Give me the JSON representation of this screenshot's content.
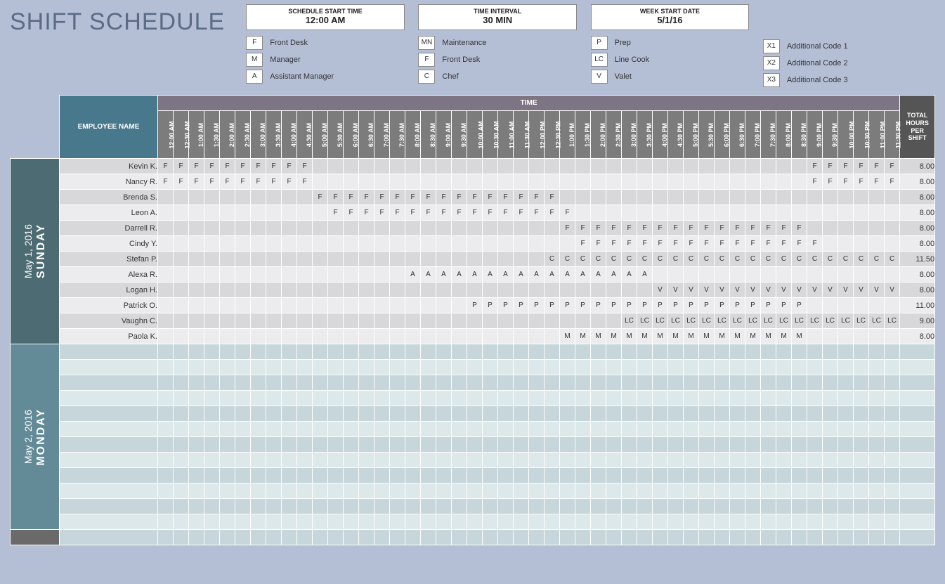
{
  "title": "SHIFT SCHEDULE",
  "params": [
    {
      "label": "SCHEDULE START TIME",
      "value": "12:00 AM"
    },
    {
      "label": "TIME INTERVAL",
      "value": "30 MIN"
    },
    {
      "label": "WEEK START DATE",
      "value": "5/1/16"
    }
  ],
  "legend_columns": [
    [
      {
        "code": "F",
        "text": "Front Desk"
      },
      {
        "code": "M",
        "text": "Manager"
      },
      {
        "code": "A",
        "text": "Assistant Manager"
      }
    ],
    [
      {
        "code": "MN",
        "text": "Maintenance"
      },
      {
        "code": "F",
        "text": "Front Desk"
      },
      {
        "code": "C",
        "text": "Chef"
      }
    ],
    [
      {
        "code": "P",
        "text": "Prep"
      },
      {
        "code": "LC",
        "text": "Line Cook"
      },
      {
        "code": "V",
        "text": "Valet"
      }
    ],
    [
      {
        "code": "X1",
        "text": "Additional Code 1"
      },
      {
        "code": "X2",
        "text": "Additional Code 2"
      },
      {
        "code": "X3",
        "text": "Additional Code 3"
      }
    ]
  ],
  "headers": {
    "employee": "EMPLOYEE NAME",
    "time_banner": "TIME",
    "total": "TOTAL HOURS PER SHIFT"
  },
  "time_slots": [
    "12:00 AM",
    "12:30 AM",
    "1:00 AM",
    "1:30 AM",
    "2:00 AM",
    "2:30 AM",
    "3:00 AM",
    "3:30 AM",
    "4:00 AM",
    "4:30 AM",
    "5:00 AM",
    "5:30 AM",
    "6:00 AM",
    "6:30 AM",
    "7:00 AM",
    "7:30 AM",
    "8:00 AM",
    "8:30 AM",
    "9:00 AM",
    "9:30 AM",
    "10:00 AM",
    "10:30 AM",
    "11:00 AM",
    "11:30 AM",
    "12:00 PM",
    "12:30 PM",
    "1:00 PM",
    "1:30 PM",
    "2:00 PM",
    "2:30 PM",
    "3:00 PM",
    "3:30 PM",
    "4:00 PM",
    "4:30 PM",
    "5:00 PM",
    "5:30 PM",
    "6:00 PM",
    "6:30 PM",
    "7:00 PM",
    "7:30 PM",
    "8:00 PM",
    "8:30 PM",
    "9:00 PM",
    "9:30 PM",
    "10:00 PM",
    "10:30 PM",
    "11:00 PM",
    "11:30 PM"
  ],
  "days": [
    {
      "name": "SUNDAY",
      "date": "May 1, 2016",
      "class": "sunday",
      "rows": [
        {
          "employee": "Kevin K.",
          "total": "8.00",
          "shift": {
            "code": "F",
            "ranges": [
              [
                0,
                9
              ],
              [
                42,
                47
              ]
            ]
          }
        },
        {
          "employee": "Nancy R.",
          "total": "8.00",
          "shift": {
            "code": "F",
            "ranges": [
              [
                0,
                9
              ],
              [
                42,
                47
              ]
            ]
          }
        },
        {
          "employee": "Brenda S.",
          "total": "8.00",
          "shift": {
            "code": "F",
            "ranges": [
              [
                10,
                25
              ]
            ]
          }
        },
        {
          "employee": "Leon A.",
          "total": "8.00",
          "shift": {
            "code": "F",
            "ranges": [
              [
                11,
                26
              ]
            ]
          }
        },
        {
          "employee": "Darrell R.",
          "total": "8.00",
          "shift": {
            "code": "F",
            "ranges": [
              [
                26,
                41
              ]
            ]
          }
        },
        {
          "employee": "Cindy Y.",
          "total": "8.00",
          "shift": {
            "code": "F",
            "ranges": [
              [
                27,
                42
              ]
            ]
          }
        },
        {
          "employee": "Stefan P.",
          "total": "11.50",
          "shift": {
            "code": "C",
            "ranges": [
              [
                25,
                47
              ]
            ]
          }
        },
        {
          "employee": "Alexa R.",
          "total": "8.00",
          "shift": {
            "code": "A",
            "ranges": [
              [
                16,
                31
              ]
            ]
          }
        },
        {
          "employee": "Logan H.",
          "total": "8.00",
          "shift": {
            "code": "V",
            "ranges": [
              [
                32,
                47
              ]
            ]
          }
        },
        {
          "employee": "Patrick O.",
          "total": "11.00",
          "shift": {
            "code": "P",
            "ranges": [
              [
                20,
                41
              ]
            ]
          }
        },
        {
          "employee": "Vaughn C.",
          "total": "9.00",
          "shift": {
            "code": "LC",
            "ranges": [
              [
                30,
                47
              ]
            ]
          }
        },
        {
          "employee": "Paola K.",
          "total": "8.00",
          "shift": {
            "code": "M",
            "ranges": [
              [
                26,
                41
              ]
            ]
          }
        }
      ]
    },
    {
      "name": "MONDAY",
      "date": "May 2, 2016",
      "class": "monday",
      "rows": [
        {
          "employee": "",
          "total": ""
        },
        {
          "employee": "",
          "total": ""
        },
        {
          "employee": "",
          "total": ""
        },
        {
          "employee": "",
          "total": ""
        },
        {
          "employee": "",
          "total": ""
        },
        {
          "employee": "",
          "total": ""
        },
        {
          "employee": "",
          "total": ""
        },
        {
          "employee": "",
          "total": ""
        },
        {
          "employee": "",
          "total": ""
        },
        {
          "employee": "",
          "total": ""
        },
        {
          "employee": "",
          "total": ""
        },
        {
          "employee": "",
          "total": ""
        }
      ]
    },
    {
      "name": "",
      "date": "",
      "class": "next",
      "rows": [
        {
          "employee": "",
          "total": ""
        }
      ]
    }
  ]
}
